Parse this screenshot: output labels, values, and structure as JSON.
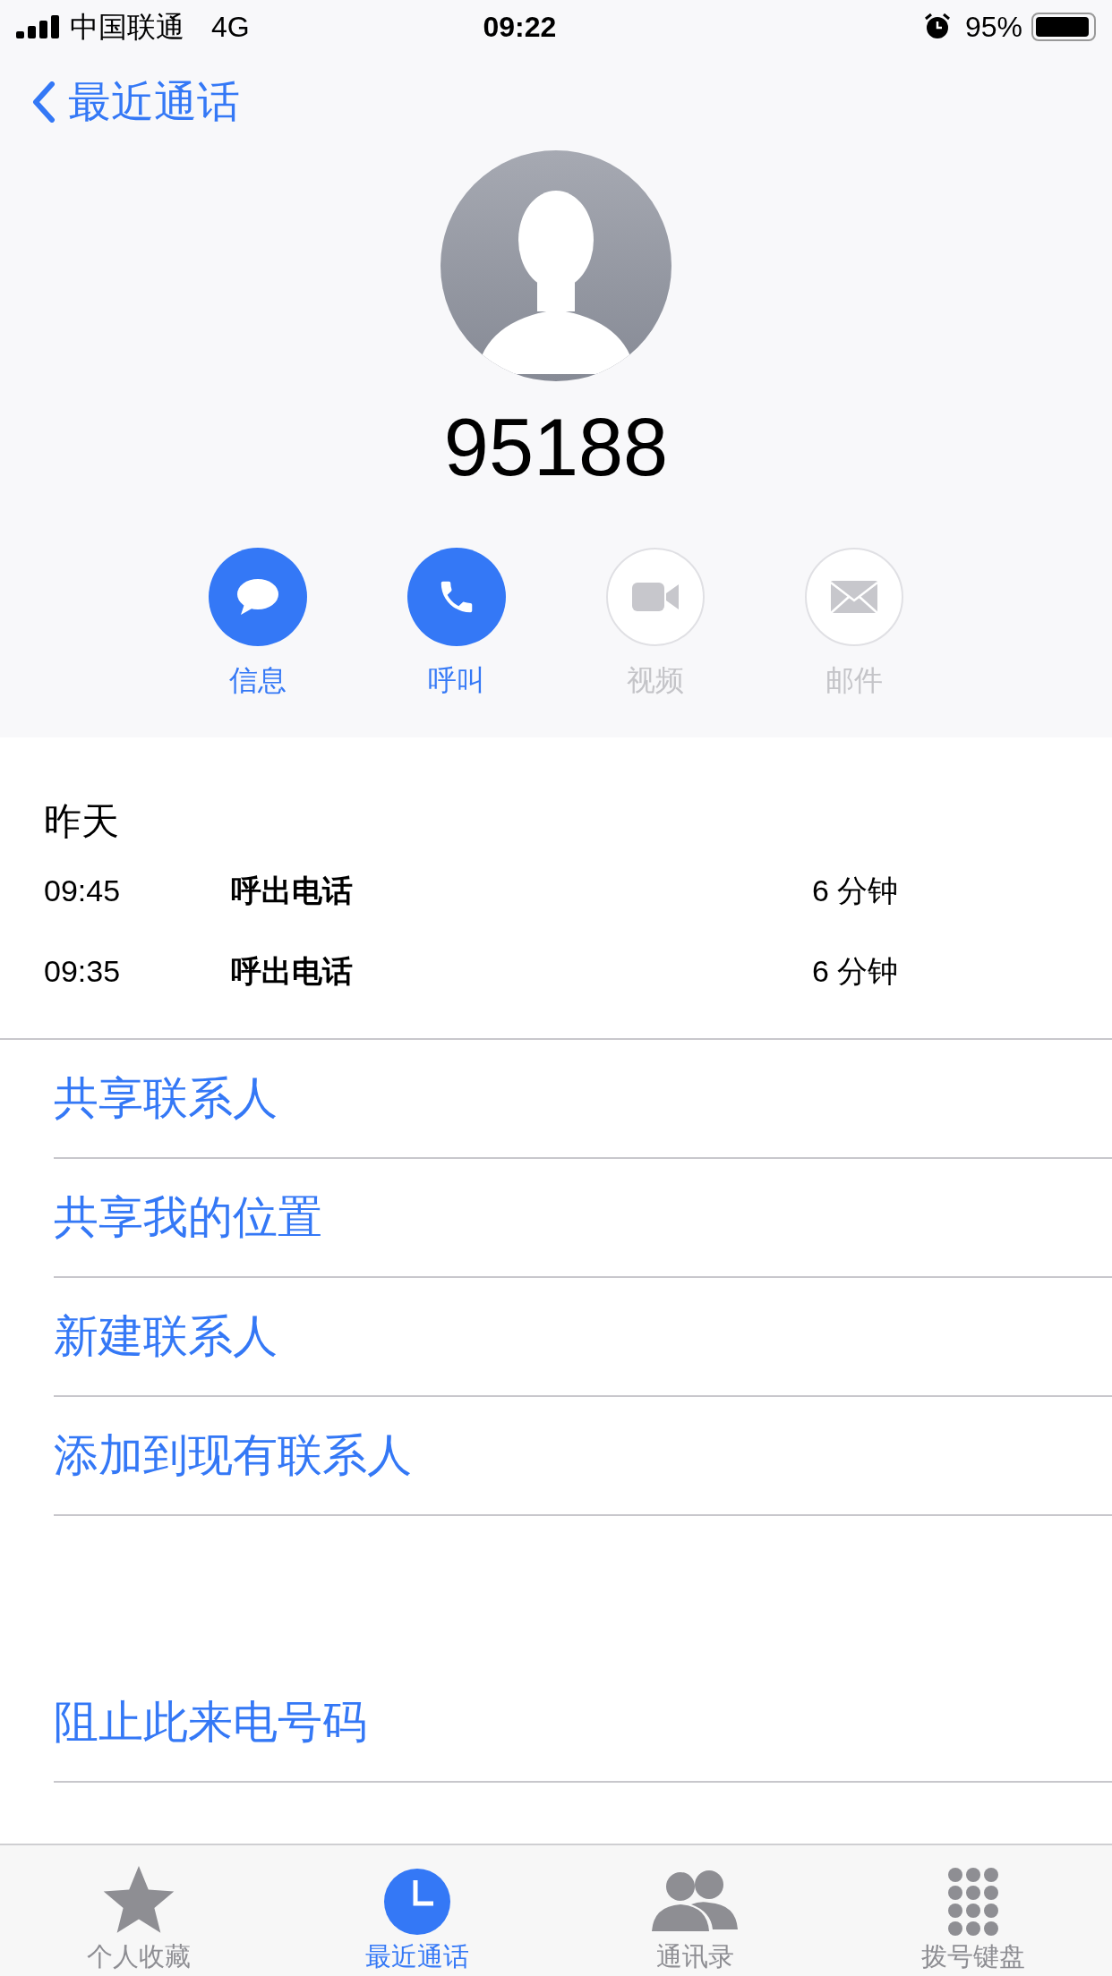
{
  "status_bar": {
    "carrier": "中国联通",
    "network": "4G",
    "time": "09:22",
    "battery": "95%"
  },
  "nav": {
    "back": "最近通话"
  },
  "contact": {
    "number": "95188"
  },
  "actions": [
    {
      "kind": "message",
      "label": "信息",
      "disabled": false
    },
    {
      "kind": "call",
      "label": "呼叫",
      "disabled": false
    },
    {
      "kind": "video",
      "label": "视频",
      "disabled": true
    },
    {
      "kind": "mail",
      "label": "邮件",
      "disabled": true
    }
  ],
  "history": {
    "date": "昨天",
    "calls": [
      {
        "time": "09:45",
        "type": "呼出电话",
        "duration": "6 分钟"
      },
      {
        "time": "09:35",
        "type": "呼出电话",
        "duration": "6 分钟"
      }
    ]
  },
  "options": [
    "共享联系人",
    "共享我的位置",
    "新建联系人",
    "添加到现有联系人"
  ],
  "block": "阻止此来电号码",
  "tabs": [
    {
      "kind": "favorites",
      "label": "个人收藏",
      "selected": false
    },
    {
      "kind": "recents",
      "label": "最近通话",
      "selected": true
    },
    {
      "kind": "contacts",
      "label": "通讯录",
      "selected": false
    },
    {
      "kind": "keypad",
      "label": "拨号键盘",
      "selected": false
    }
  ]
}
